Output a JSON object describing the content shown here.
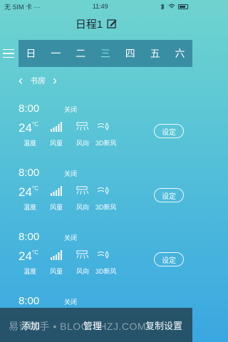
{
  "status_bar": {
    "carrier": "无 SIM 卡 ···",
    "time": "11:49",
    "icons": [
      "bluetooth-icon",
      "wifi-icon",
      "battery-icon"
    ]
  },
  "header": {
    "title": "日程1",
    "edit_icon": "edit-icon"
  },
  "week": {
    "days": [
      "日",
      "一",
      "二",
      "三",
      "四",
      "五",
      "六"
    ],
    "active_index": 3
  },
  "room": {
    "name": "书房",
    "prev_icon": "chevron-left-icon",
    "next_icon": "chevron-right-icon"
  },
  "schedules": [
    {
      "time": "8:00",
      "status": "关闭",
      "temp": "24",
      "unit": "°C",
      "labels": {
        "temp": "温度",
        "fan": "风量",
        "dir": "风向",
        "fresh": "3D新风"
      },
      "button": "设定"
    },
    {
      "time": "8:00",
      "status": "关闭",
      "temp": "24",
      "unit": "°C",
      "labels": {
        "temp": "温度",
        "fan": "风量",
        "dir": "风向",
        "fresh": "3D新风"
      },
      "button": "设定"
    },
    {
      "time": "8:00",
      "status": "关闭",
      "temp": "24",
      "unit": "°C",
      "labels": {
        "temp": "温度",
        "fan": "风量",
        "dir": "风向",
        "fresh": "3D新风"
      },
      "button": "设定"
    },
    {
      "time": "8:00",
      "status": "关闭"
    }
  ],
  "bottom_bar": {
    "add": "添加",
    "manage": "管理",
    "copy": "复制设置"
  },
  "watermark": "易评助手 • BLOG.SHZJ.COM"
}
